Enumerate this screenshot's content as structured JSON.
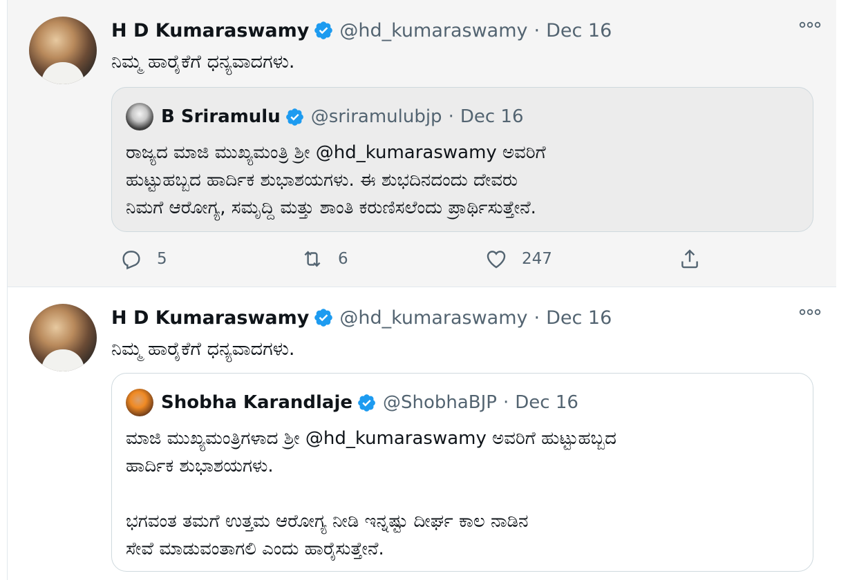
{
  "tweets": [
    {
      "author": {
        "name": "H D Kumaraswamy",
        "handle": "@hd_kumaraswamy",
        "date": "Dec 16"
      },
      "text": "ನಿಮ್ಮ ಹಾರೈಕೆಗೆ ಧನ್ಯವಾದಗಳು.",
      "quote": {
        "author": {
          "name": "B Sriramulu",
          "handle": "@sriramulubjp",
          "date": "Dec 16"
        },
        "text": "ರಾಜ್ಯದ ಮಾಜಿ ಮುಖ್ಯಮಂತ್ರಿ ಶ್ರೀ @hd_kumaraswamy ಅವರಿಗೆ\nಹುಟ್ಟುಹಬ್ಬದ ಹಾರ್ದಿಕ  ಶುಭಾಶಯಗಳು. ಈ ಶುಭದಿನದಂದು ದೇವರು\nನಿಮಗೆ ಆರೋಗ್ಯ, ಸಮೃದ್ದಿ ಮತ್ತು ಶಾಂತಿ ಕರುಣಿಸಲೆಂದು ಪ್ರಾರ್ಥಿಸುತ್ತೇನೆ."
      },
      "stats": {
        "replies": "5",
        "retweets": "6",
        "likes": "247"
      }
    },
    {
      "author": {
        "name": "H D Kumaraswamy",
        "handle": "@hd_kumaraswamy",
        "date": "Dec 16"
      },
      "text": "ನಿಮ್ಮ ಹಾರೈಕೆಗೆ ಧನ್ಯವಾದಗಳು.",
      "quote": {
        "author": {
          "name": "Shobha Karandlaje",
          "handle": "@ShobhaBJP",
          "date": "Dec 16"
        },
        "text": "ಮಾಜಿ ಮುಖ್ಯಮಂತ್ರಿಗಳಾದ ಶ್ರೀ @hd_kumaraswamy ಅವರಿಗೆ ಹುಟ್ಟುಹಬ್ಬದ\nಹಾರ್ದಿಕ ಶುಭಾಶಯಗಳು.\n\nಭಗವಂತ ತಮಗೆ ಉತ್ತಮ ಆರೋಗ್ಯ ನೀಡಿ ಇನ್ನಷ್ಟು ದೀರ್ಘ ಕಾಲ ನಾಡಿನ\nಸೇವೆ ಮಾಡುವಂತಾಗಲಿ ಎಂದು ಹಾರೈಸುತ್ತೇನೆ."
      }
    }
  ],
  "icons": {
    "verified": "verified-badge-icon",
    "more": "more-options-icon",
    "reply": "reply-icon",
    "retweet": "retweet-icon",
    "like": "heart-icon",
    "share": "share-icon"
  },
  "colors": {
    "verified": "#1d9bf0",
    "secondary_text": "#536471",
    "border": "#cfd9de"
  }
}
